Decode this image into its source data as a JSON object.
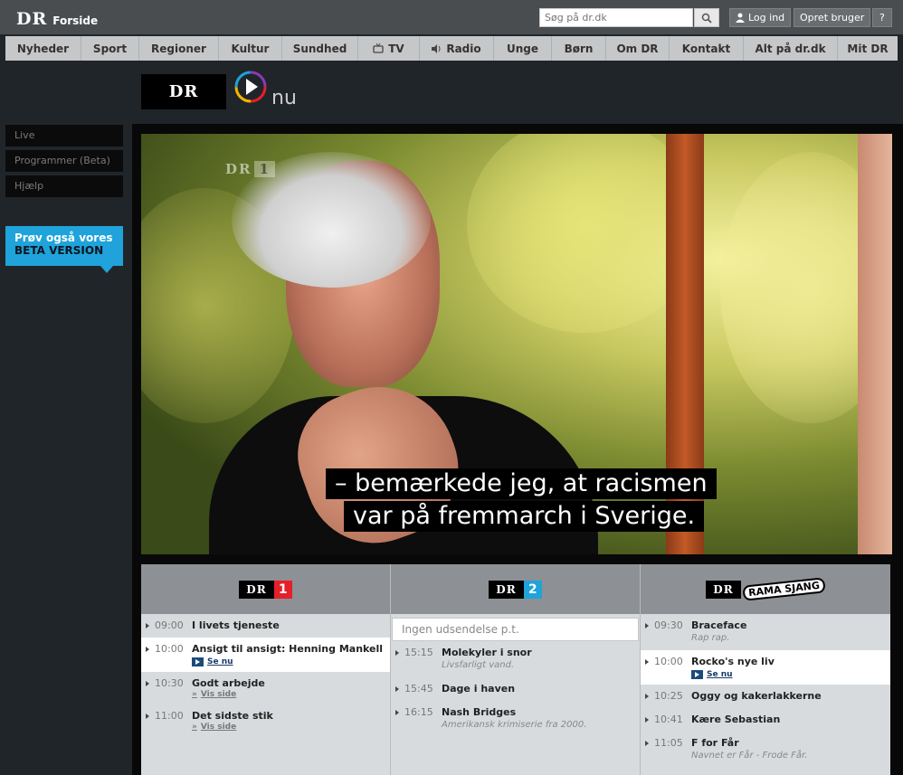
{
  "topbar": {
    "logo": "DR",
    "forside": "Forside",
    "search_placeholder": "Søg på dr.dk",
    "login": "Log ind",
    "signup": "Opret bruger",
    "help": "?"
  },
  "nav": [
    {
      "label": "Nyheder",
      "icon": ""
    },
    {
      "label": "Sport",
      "icon": ""
    },
    {
      "label": "Regioner",
      "icon": ""
    },
    {
      "label": "Kultur",
      "icon": ""
    },
    {
      "label": "Sundhed",
      "icon": ""
    },
    {
      "label": "TV",
      "icon": "tv-icon"
    },
    {
      "label": "Radio",
      "icon": "speaker-icon"
    },
    {
      "label": "Unge",
      "icon": ""
    },
    {
      "label": "Børn",
      "icon": ""
    },
    {
      "label": "Om DR",
      "icon": ""
    },
    {
      "label": "Kontakt",
      "icon": ""
    },
    {
      "label": "Alt på dr.dk",
      "icon": ""
    },
    {
      "label": "Mit DR",
      "icon": ""
    }
  ],
  "drnu": {
    "dr": "DR",
    "nu": "nu"
  },
  "sidebar": {
    "items": [
      "Live",
      "Programmer (Beta)",
      "Hjælp"
    ],
    "beta_line1": "Prøv også vores",
    "beta_line2": "BETA VERSION"
  },
  "video": {
    "channel_bug": "DR",
    "channel_num": "1",
    "subtitle_line1": "– bemærkede jeg, at racismen",
    "subtitle_line2": "var på fremmarch i Sverige."
  },
  "schedule": {
    "dr1": {
      "num": "1",
      "num_color": "#e4202a",
      "programs": [
        {
          "time": "09:00",
          "title": "I livets tjeneste",
          "desc": "",
          "link": "",
          "active": false
        },
        {
          "time": "10:00",
          "title": "Ansigt til ansigt: Henning Mankell",
          "desc": "",
          "link": "Se nu",
          "active": true
        },
        {
          "time": "10:30",
          "title": "Godt arbejde",
          "desc": "",
          "link": "Vis side",
          "active": false
        },
        {
          "time": "11:00",
          "title": "Det sidste stik",
          "desc": "",
          "link": "Vis side",
          "active": false
        }
      ]
    },
    "dr2": {
      "num": "2",
      "num_color": "#1fa3da",
      "none": "Ingen udsendelse p.t.",
      "programs": [
        {
          "time": "15:15",
          "title": "Molekyler i snor",
          "desc": "Livsfarligt vand."
        },
        {
          "time": "15:45",
          "title": "Dage i haven",
          "desc": ""
        },
        {
          "time": "16:15",
          "title": "Nash Bridges",
          "desc": "Amerikansk krimiserie fra 2000."
        }
      ]
    },
    "ramasjang": {
      "logo_text": "RAMA SJANG",
      "programs": [
        {
          "time": "09:30",
          "title": "Braceface",
          "desc": "Rap rap.",
          "link": "",
          "active": false
        },
        {
          "time": "10:00",
          "title": "Rocko's nye liv",
          "desc": "",
          "link": "Se nu",
          "active": true
        },
        {
          "time": "10:25",
          "title": "Oggy og kakerlakkerne",
          "desc": "",
          "link": "",
          "active": false
        },
        {
          "time": "10:41",
          "title": "Kære Sebastian",
          "desc": "",
          "link": "",
          "active": false
        },
        {
          "time": "11:05",
          "title": "F for Får",
          "desc": "Navnet er Får - Frode Får.",
          "link": "",
          "active": false
        }
      ]
    }
  }
}
